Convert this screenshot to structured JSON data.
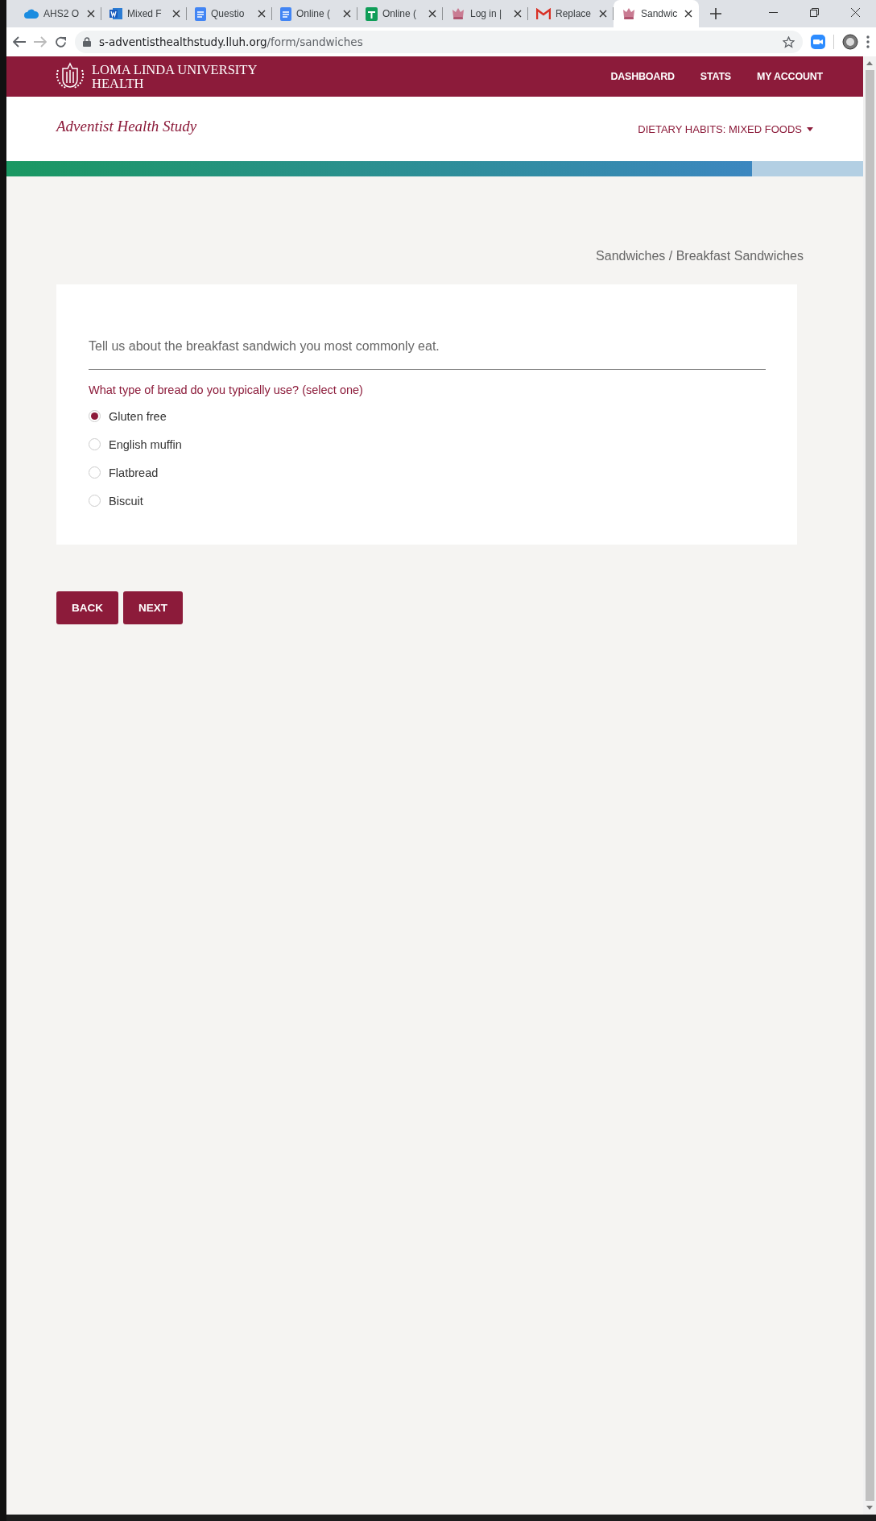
{
  "browser": {
    "tabs": [
      {
        "title": "AHS2 O",
        "kind": "cloud",
        "selected": false
      },
      {
        "title": "Mixed F",
        "kind": "word",
        "selected": false
      },
      {
        "title": "Questio",
        "kind": "doc",
        "selected": false
      },
      {
        "title": "Online (",
        "kind": "doc",
        "selected": false
      },
      {
        "title": "Online (",
        "kind": "sheet",
        "selected": false
      },
      {
        "title": "Log in |",
        "kind": "crest",
        "selected": false
      },
      {
        "title": "Replace",
        "kind": "mail",
        "selected": false
      },
      {
        "title": "Sandwic",
        "kind": "crest",
        "selected": true
      }
    ],
    "url_host": "s-adventisthealthstudy.lluh.org",
    "url_path": "/form/sandwiches"
  },
  "header": {
    "brand": "LOMA LINDA UNIVERSITY HEALTH",
    "nav": [
      "DASHBOARD",
      "STATS",
      "MY ACCOUNT"
    ]
  },
  "subheader": {
    "title": "Adventist Health Study",
    "section_menu": "DIETARY HABITS: MIXED FOODS"
  },
  "progress": {
    "level": 0.87
  },
  "breadcrumb": "Sandwiches / Breakfast Sandwiches",
  "card": {
    "intro": "Tell us about the breakfast sandwich you most commonly eat.",
    "question": "What type of bread do you typically use? (select one)",
    "options": [
      {
        "label": "Gluten free",
        "selected": true
      },
      {
        "label": "English muffin",
        "selected": false
      },
      {
        "label": "Flatbread",
        "selected": false
      },
      {
        "label": "Biscuit",
        "selected": false
      }
    ]
  },
  "buttons": [
    "BACK",
    "NEXT"
  ]
}
